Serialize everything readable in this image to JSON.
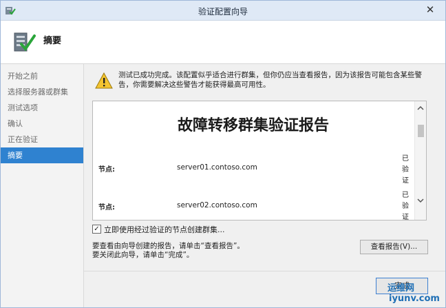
{
  "window": {
    "title": "验证配置向导",
    "close_label": "✕"
  },
  "header": {
    "title": "摘要"
  },
  "nav": {
    "items": [
      {
        "label": "开始之前",
        "active": false
      },
      {
        "label": "选择服务器或群集",
        "active": false
      },
      {
        "label": "测试选项",
        "active": false
      },
      {
        "label": "确认",
        "active": false
      },
      {
        "label": "正在验证",
        "active": false
      },
      {
        "label": "摘要",
        "active": true
      }
    ]
  },
  "main": {
    "warning_text": "测试已成功完成。该配置似乎适合进行群集，但你仍应当查看报告，因为该报告可能包含某些警告，你需要解决这些警告才能获得最高可用性。",
    "report": {
      "title": "故障转移群集验证报告",
      "rows": [
        {
          "label": "节点:",
          "value": "server01.contoso.com",
          "status": "已验证"
        },
        {
          "label": "节点:",
          "value": "server02.contoso.com",
          "status": "已验证"
        }
      ]
    },
    "checkbox": {
      "label": "立即使用经过验证的节点创建群集...",
      "checked": true
    },
    "hint1": "要查看由向导创建的报告，请单击“查看报告”。",
    "hint2": "要关闭此向导，请单击“完成”。",
    "view_report_button": "查看报告(V)...",
    "finish_button": "完成"
  },
  "watermark": {
    "line1": "运维网",
    "line2": "iyunv.com"
  },
  "icons": {
    "warning": "warning-icon",
    "wizard": "wizard-icon",
    "scroll_up": "chevron-up-icon",
    "scroll_down": "chevron-down-icon"
  }
}
